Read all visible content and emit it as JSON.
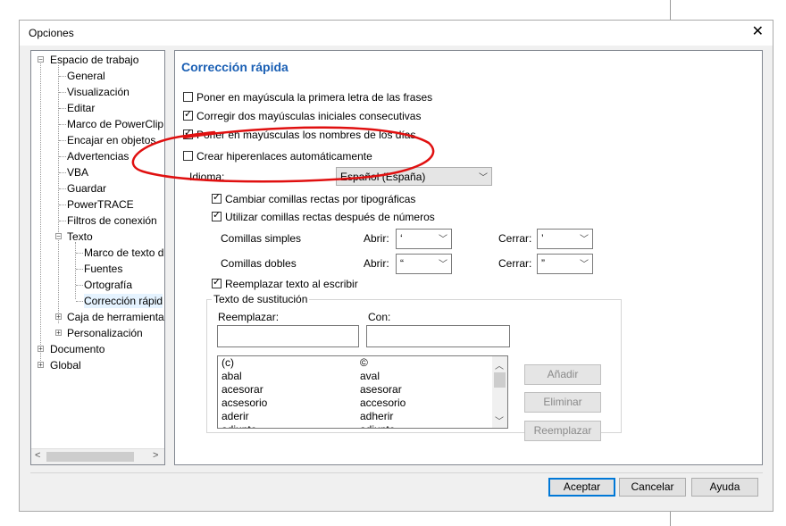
{
  "window": {
    "title": "Opciones",
    "close_glyph": "✕"
  },
  "tree": {
    "items": [
      {
        "label": "Espacio de trabajo",
        "expander": "−"
      },
      {
        "label": "General"
      },
      {
        "label": "Visualización"
      },
      {
        "label": "Editar"
      },
      {
        "label": "Marco de PowerClip"
      },
      {
        "label": "Encajar en objetos"
      },
      {
        "label": "Advertencias"
      },
      {
        "label": "VBA"
      },
      {
        "label": "Guardar"
      },
      {
        "label": "PowerTRACE"
      },
      {
        "label": "Filtros de conexión"
      },
      {
        "label": "Texto",
        "expander": "−"
      },
      {
        "label": "Marco de texto d"
      },
      {
        "label": "Fuentes"
      },
      {
        "label": "Ortografía"
      },
      {
        "label": "Corrección rápid"
      },
      {
        "label": "Caja de herramienta",
        "expander": "+"
      },
      {
        "label": "Personalización",
        "expander": "+"
      },
      {
        "label": "Documento",
        "expander": "+"
      },
      {
        "label": "Global",
        "expander": "+"
      }
    ],
    "scroll_left": "<",
    "scroll_right": ">"
  },
  "panel": {
    "title": "Corrección rápida",
    "options": [
      {
        "label": "Poner en mayúscula la primera letra de las frases",
        "checked": false
      },
      {
        "label": "Corregir dos mayúsculas iniciales consecutivas",
        "checked": true
      },
      {
        "label": "Poner en mayúsculas los nombres de los días",
        "checked": true
      },
      {
        "label": "Crear hiperenlaces automáticamente",
        "checked": false
      }
    ],
    "idioma_label": "Idioma:",
    "idioma_value": "Español (España)",
    "quote_options": [
      {
        "label": "Cambiar comillas rectas por tipográficas",
        "checked": true
      },
      {
        "label": "Utilizar comillas rectas después de números",
        "checked": true
      }
    ],
    "comillas_simples": {
      "label": "Comillas simples",
      "abrir_label": "Abrir:",
      "abrir_value": "‘",
      "cerrar_label": "Cerrar:",
      "cerrar_value": "’"
    },
    "comillas_dobles": {
      "label": "Comillas dobles",
      "abrir_label": "Abrir:",
      "abrir_value": "“",
      "cerrar_label": "Cerrar:",
      "cerrar_value": "”"
    },
    "replace_option": {
      "label": "Reemplazar texto al escribir",
      "checked": true
    },
    "sustitucion": {
      "group_title": "Texto de sustitución",
      "reemplazar_label": "Reemplazar:",
      "con_label": "Con:",
      "reemplazar_value": "",
      "con_value": "",
      "rows": [
        {
          "from": "(c)",
          "to": "©"
        },
        {
          "from": "abal",
          "to": "aval"
        },
        {
          "from": "acesorar",
          "to": "asesorar"
        },
        {
          "from": "acsesorio",
          "to": "accesorio"
        },
        {
          "from": "aderir",
          "to": "adherir"
        },
        {
          "from": "adjunto",
          "to": "adjunto"
        }
      ],
      "add_label": "Añadir",
      "delete_label": "Eliminar",
      "replace_label": "Reemplazar"
    }
  },
  "footer": {
    "ok_label": "Aceptar",
    "cancel_label": "Cancelar",
    "help_label": "Ayuda"
  },
  "colors": {
    "accent": "#1a5fb4",
    "annotation": "#e01010"
  }
}
